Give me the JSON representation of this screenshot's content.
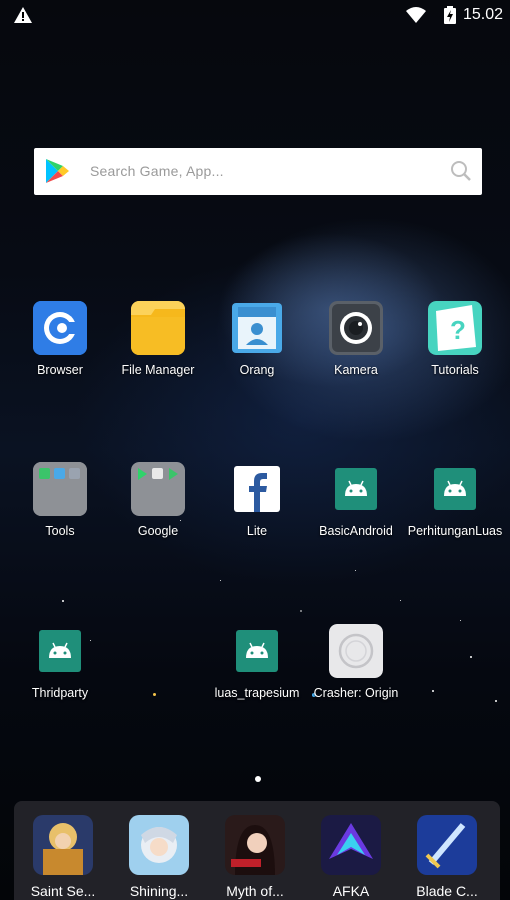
{
  "status_bar": {
    "time": "15.02",
    "icons": [
      "warning-icon",
      "wifi-icon",
      "battery-icon"
    ]
  },
  "search": {
    "placeholder": "Search Game, App...",
    "icons": [
      "play-store-icon",
      "search-icon"
    ]
  },
  "apps_row1": [
    {
      "label": "Browser",
      "icon": "browser-icon"
    },
    {
      "label": "File Manager",
      "icon": "folder-icon"
    },
    {
      "label": "Orang",
      "icon": "contacts-icon"
    },
    {
      "label": "Kamera",
      "icon": "camera-icon"
    },
    {
      "label": "Tutorials",
      "icon": "tutorials-icon"
    }
  ],
  "apps_row2": [
    {
      "label": "Tools",
      "icon": "folder-group-icon"
    },
    {
      "label": "Google",
      "icon": "folder-group-icon"
    },
    {
      "label": "Lite",
      "icon": "facebook-icon"
    },
    {
      "label": "BasicAndroid",
      "icon": "android-icon"
    },
    {
      "label": "PerhitunganLuas",
      "icon": "android-icon"
    }
  ],
  "apps_row3": [
    {
      "label": "Thridparty",
      "icon": "android-icon"
    },
    {
      "label": "luas_trapesium",
      "icon": "android-icon"
    },
    {
      "label": "Crasher: Origin",
      "icon": "crasher-icon"
    }
  ],
  "dock": [
    {
      "label": "Saint Se...",
      "icon": "game-icon"
    },
    {
      "label": "Shining...",
      "icon": "game-icon"
    },
    {
      "label": "Myth of...",
      "icon": "game-icon"
    },
    {
      "label": "AFKA",
      "icon": "game-icon"
    },
    {
      "label": "Blade C...",
      "icon": "game-icon"
    }
  ],
  "colors": {
    "android_tile": "#1f8f7a",
    "browser_tile": "#2f7de6",
    "folder_tile": "#f6b81c",
    "dock_bg": "#28282e"
  }
}
